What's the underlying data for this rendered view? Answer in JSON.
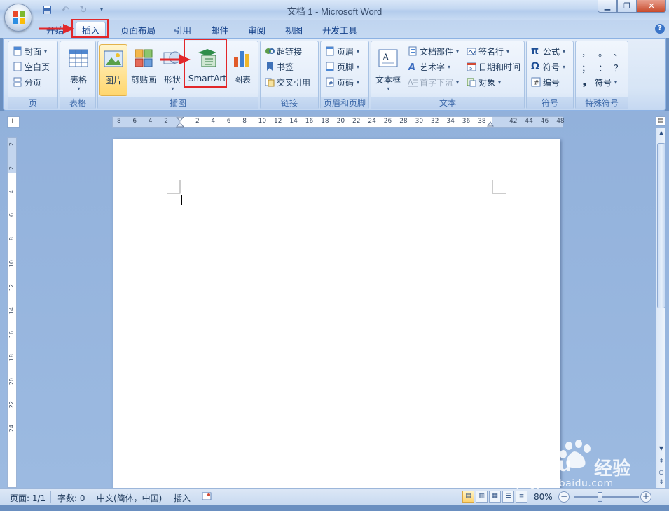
{
  "window": {
    "title": "文档 1 - Microsoft Word",
    "minimize": "▁",
    "restore": "❐",
    "close": "✕"
  },
  "quick_access": {
    "save": "💾",
    "undo": "↶",
    "redo": "↻",
    "more": "▾"
  },
  "tabs": [
    {
      "label": "开始",
      "active": false
    },
    {
      "label": "插入",
      "active": true
    },
    {
      "label": "页面布局",
      "active": false
    },
    {
      "label": "引用",
      "active": false
    },
    {
      "label": "邮件",
      "active": false
    },
    {
      "label": "审阅",
      "active": false
    },
    {
      "label": "视图",
      "active": false
    },
    {
      "label": "开发工具",
      "active": false
    }
  ],
  "help": "?",
  "ribbon": {
    "pages": {
      "label": "页",
      "items": [
        "封面",
        "空白页",
        "分页"
      ]
    },
    "tables": {
      "label": "表格",
      "item": "表格"
    },
    "illustrations": {
      "label": "插图",
      "items": [
        "图片",
        "剪贴画",
        "形状",
        "SmartArt",
        "图表"
      ]
    },
    "links": {
      "label": "链接",
      "items": [
        "超链接",
        "书签",
        "交叉引用"
      ]
    },
    "header_footer": {
      "label": "页眉和页脚",
      "items": [
        "页眉",
        "页脚",
        "页码"
      ]
    },
    "text": {
      "label": "文本",
      "textbox": "文本框",
      "col1": [
        "文档部件",
        "艺术字",
        "首字下沉"
      ],
      "col2": [
        "签名行",
        "日期和时间",
        "对象"
      ]
    },
    "symbols": {
      "label": "符号",
      "items": [
        "公式",
        "符号",
        "编号"
      ]
    },
    "special_symbols": {
      "label": "特殊符号",
      "row1": [
        "，",
        "。",
        "、"
      ],
      "row2": [
        "；",
        "：",
        "？"
      ],
      "more": "符号"
    }
  },
  "ruler": {
    "corner": "L",
    "h_ticks": [
      "8",
      "6",
      "4",
      "2",
      "2",
      "4",
      "6",
      "8",
      "10",
      "12",
      "14",
      "16",
      "18",
      "20",
      "22",
      "24",
      "26",
      "28",
      "30",
      "32",
      "34",
      "36",
      "38",
      "42",
      "44",
      "46",
      "48"
    ],
    "v_ticks": [
      "2",
      "2",
      "4",
      "6",
      "8",
      "10",
      "12",
      "14",
      "16",
      "18",
      "20",
      "22",
      "24"
    ]
  },
  "statusbar": {
    "page": "页面: 1/1",
    "words": "字数: 0",
    "language": "中文(简体，中国)",
    "mode": "插入",
    "zoom": "80%",
    "zoom_level_percent": 80
  },
  "watermark": {
    "brand": "Baidu",
    "brand_cn": "经验",
    "url": "jingyan.baidu.com"
  },
  "colors": {
    "highlight_box": "#e2272a",
    "ribbon_text": "#15428b"
  }
}
